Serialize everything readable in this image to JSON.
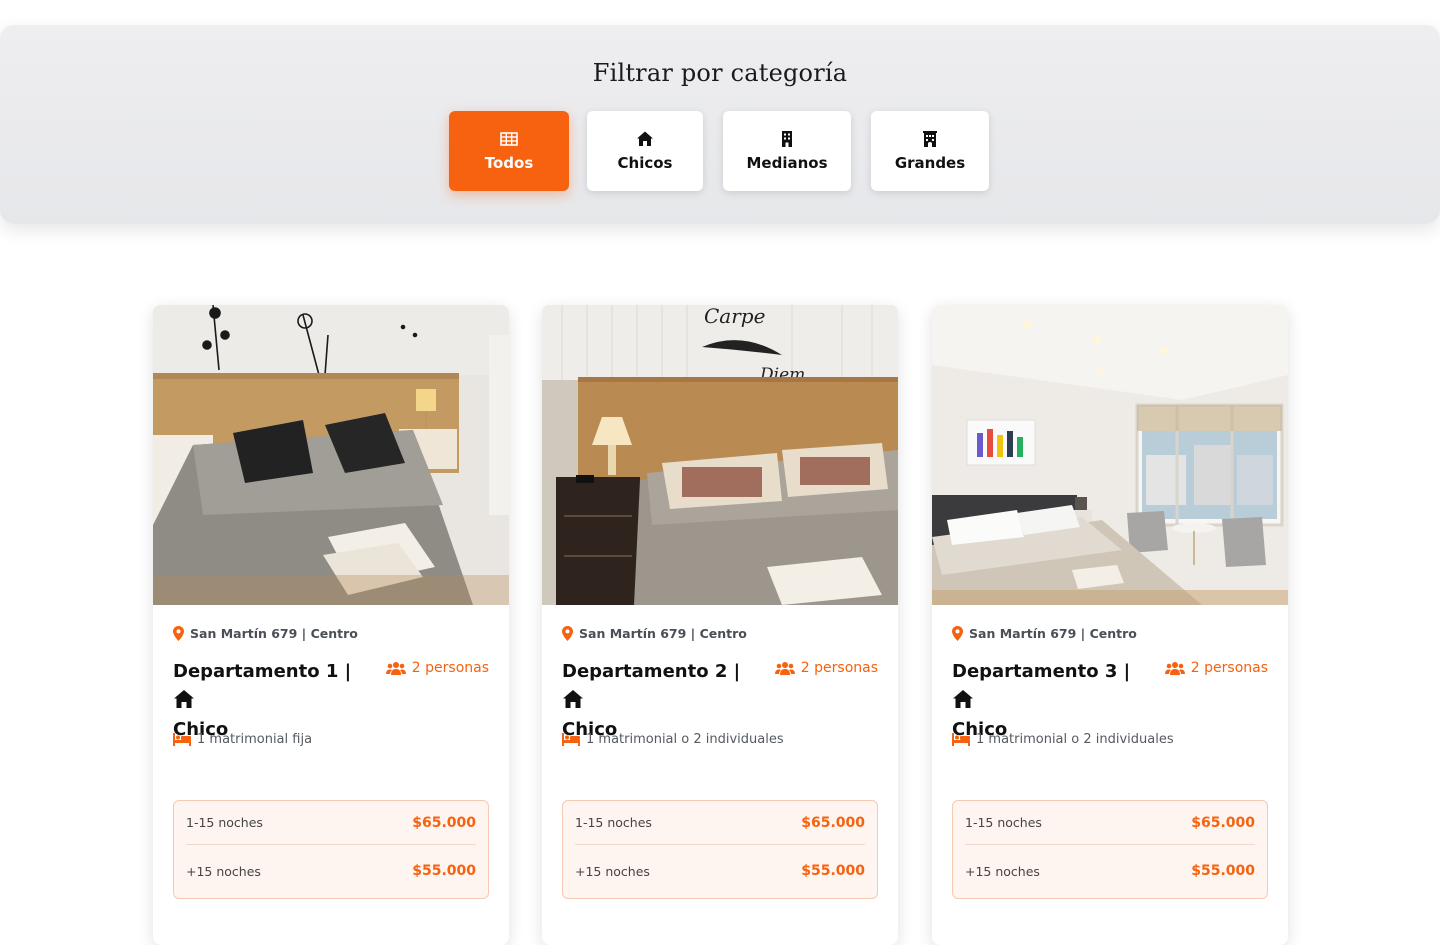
{
  "filter": {
    "title": "Filtrar por categoría",
    "accent": "#f6620f",
    "buttons": [
      {
        "label": "Todos",
        "icon": "grid-icon",
        "active": true
      },
      {
        "label": "Chicos",
        "icon": "home-icon",
        "active": false
      },
      {
        "label": "Medianos",
        "icon": "building-icon",
        "active": false
      },
      {
        "label": "Grandes",
        "icon": "hotel-icon",
        "active": false
      }
    ]
  },
  "cards": [
    {
      "address": "San Martín 679 | Centro",
      "title_prefix": "Departamento 1 |",
      "category": "Chico",
      "people": "2 personas",
      "beds": "1 matrimonial fija",
      "prices": [
        {
          "label": "1-15 noches",
          "value": "$65.000"
        },
        {
          "label": "+15 noches",
          "value": "$55.000"
        }
      ]
    },
    {
      "address": "San Martín 679 | Centro",
      "title_prefix": "Departamento 2 |",
      "category": "Chico",
      "people": "2 personas",
      "beds": "1 matrimonial o 2 individuales",
      "prices": [
        {
          "label": "1-15 noches",
          "value": "$65.000"
        },
        {
          "label": "+15 noches",
          "value": "$55.000"
        }
      ]
    },
    {
      "address": "San Martín 679 | Centro",
      "title_prefix": "Departamento 3 |",
      "category": "Chico",
      "people": "2 personas",
      "beds": "1 matrimonial o 2 individuales",
      "prices": [
        {
          "label": "1-15 noches",
          "value": "$65.000"
        },
        {
          "label": "+15 noches",
          "value": "$55.000"
        }
      ]
    }
  ],
  "photo_wall_text": [
    "Carpe",
    "Diem"
  ]
}
